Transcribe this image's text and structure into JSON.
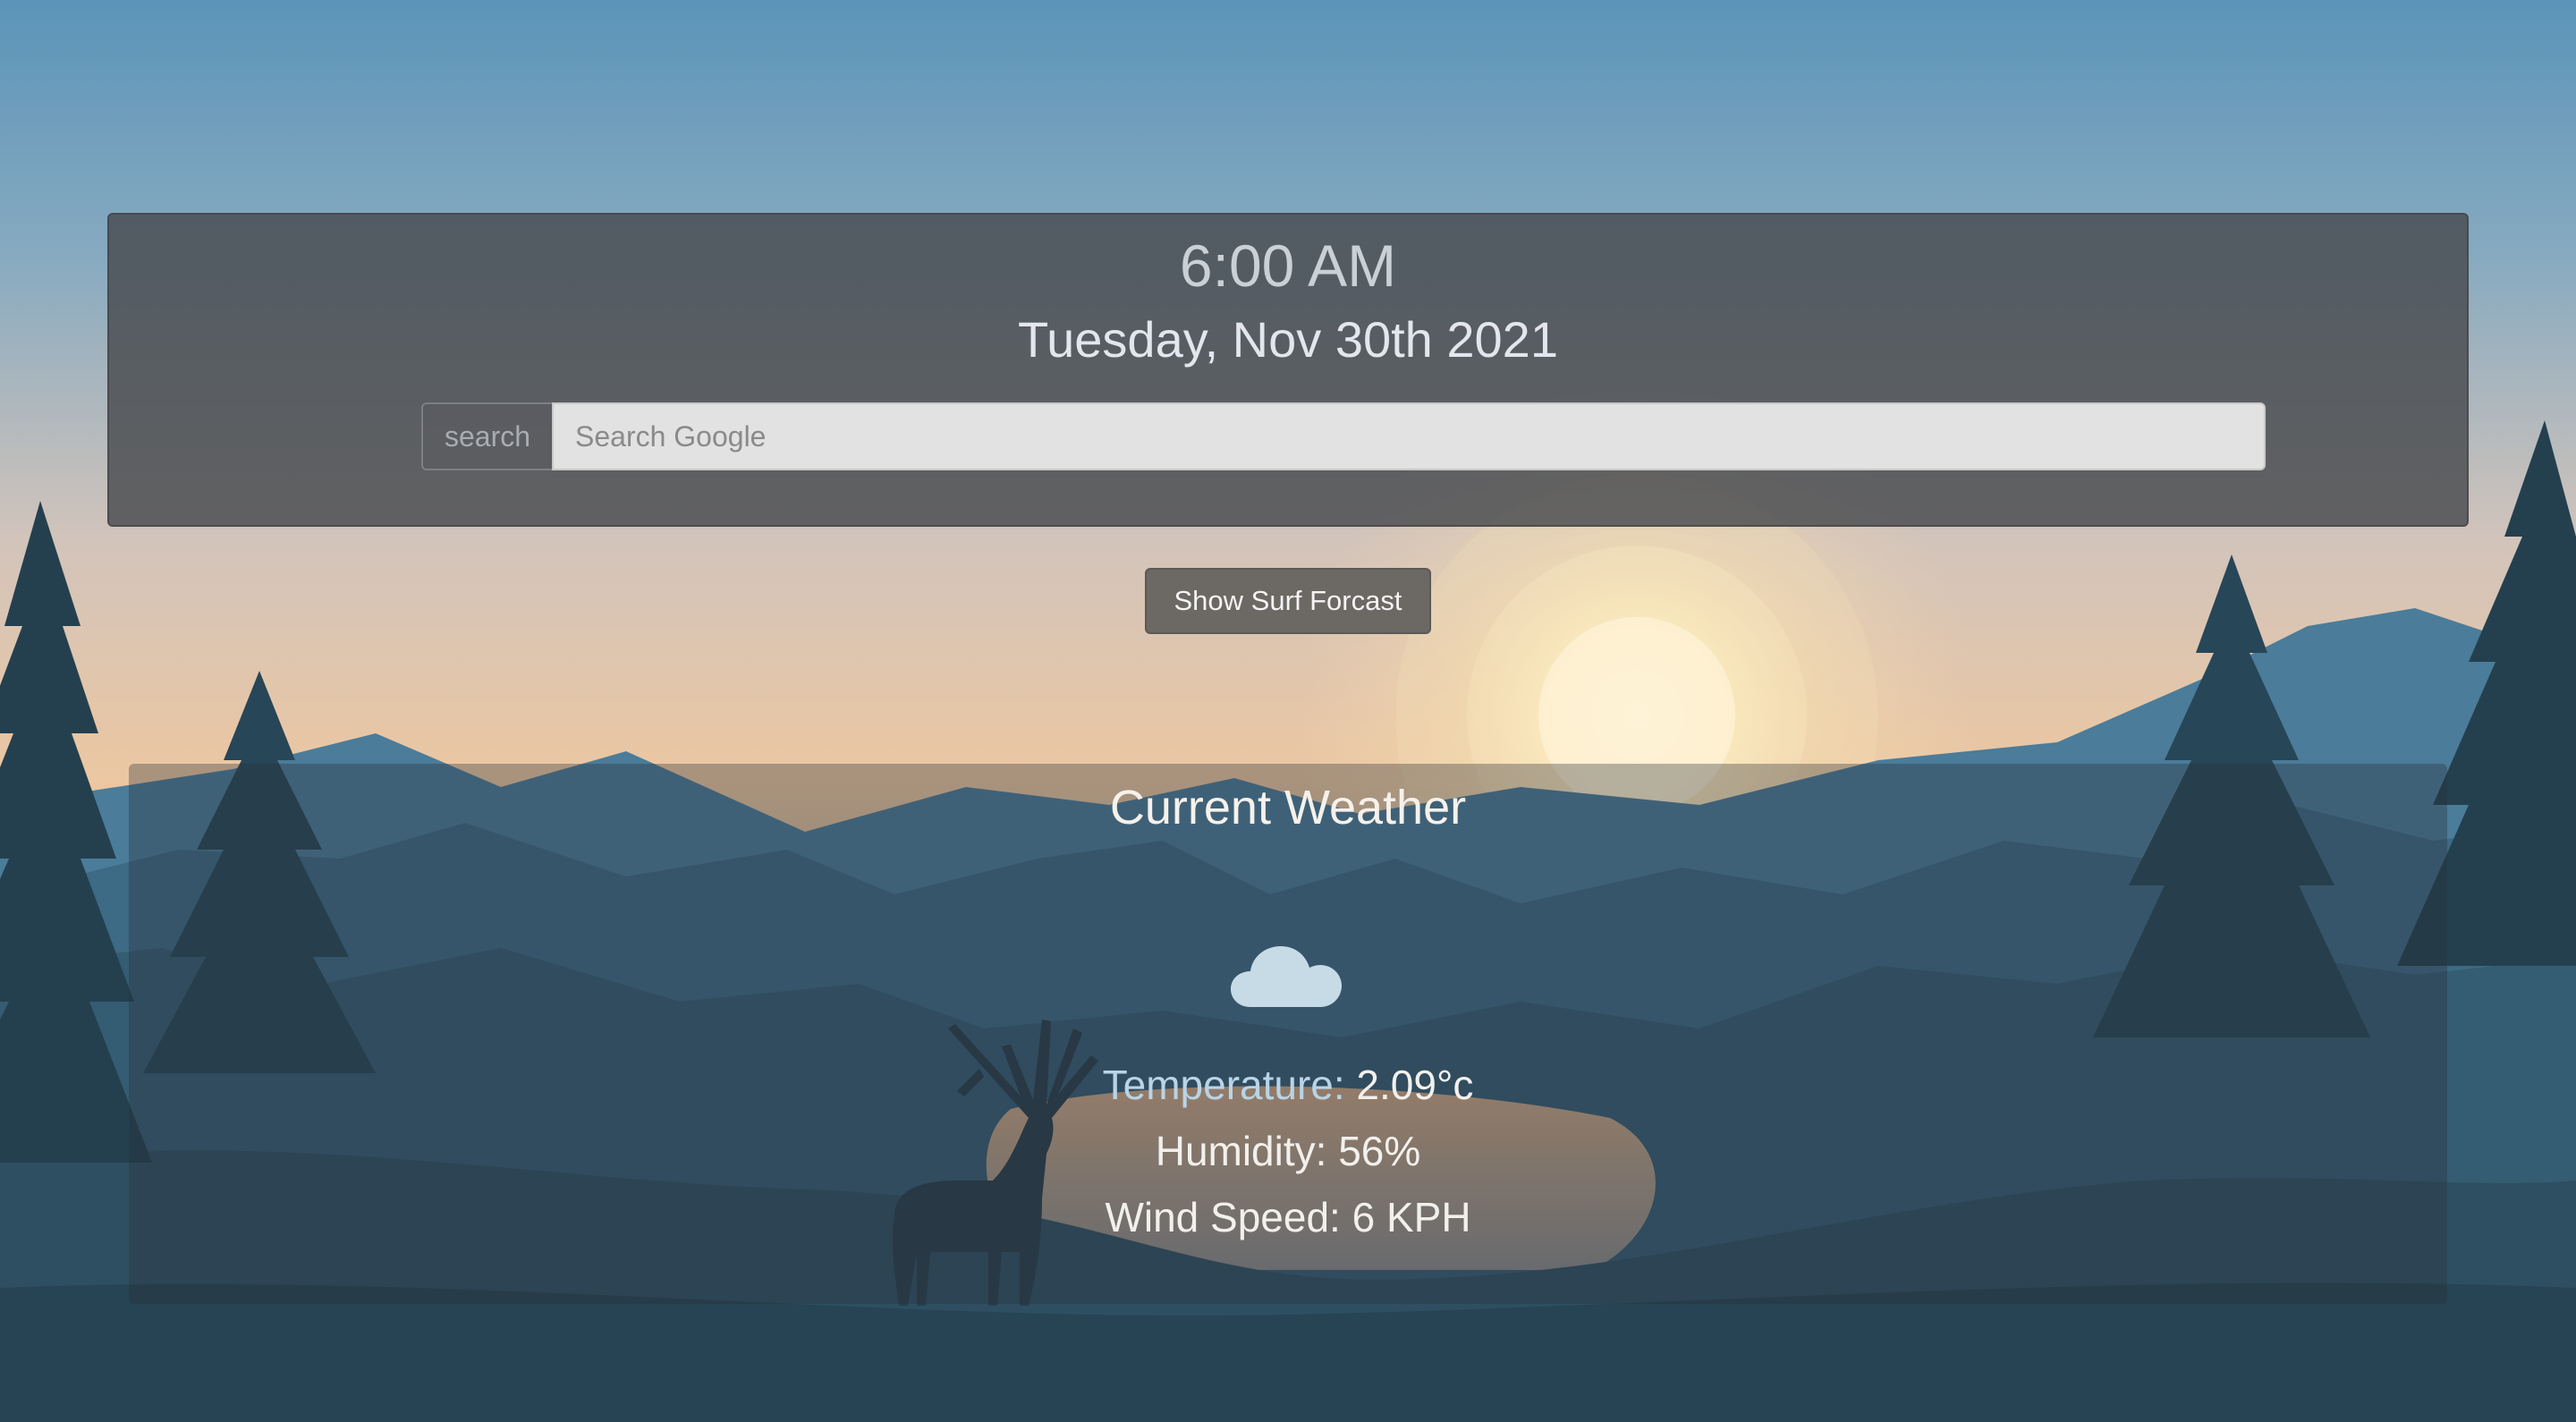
{
  "header": {
    "time": "6:00 AM",
    "date": "Tuesday, Nov 30th 2021"
  },
  "search": {
    "label": "search",
    "placeholder": "Search Google"
  },
  "surf_button": {
    "label": "Show Surf Forcast"
  },
  "weather": {
    "title": "Current Weather",
    "icon": "cloud-icon",
    "temperature_label": "Temperature:",
    "temperature_value": "2.09°c",
    "humidity": "Humidity: 56%",
    "wind_speed": "Wind Speed: 6 KPH"
  },
  "colors": {
    "sky_top": "#5e95b8",
    "sky_horizon": "#e9c9a4",
    "mountain_far": "#4a7894",
    "mountain_near": "#2f5568",
    "tree": "#24404f",
    "panel": "#4e5055",
    "button": "#6c6864"
  }
}
